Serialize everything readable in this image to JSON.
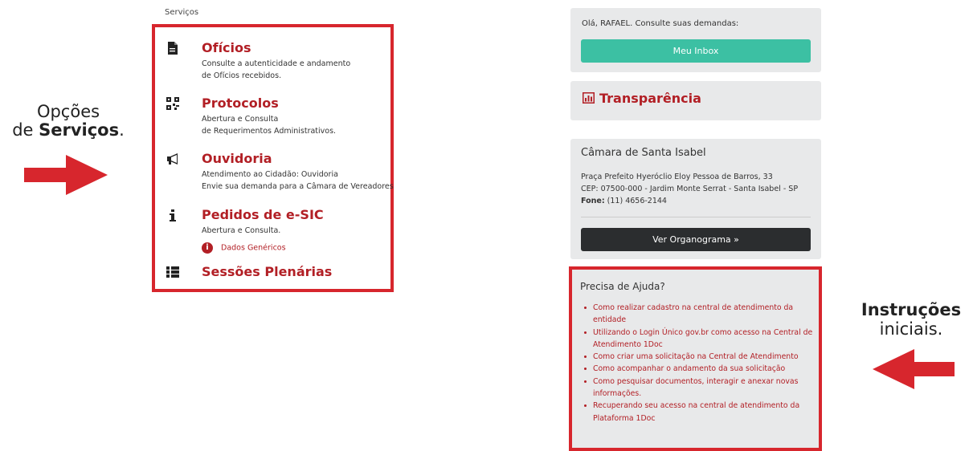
{
  "annotations": {
    "left_line1": "Opções",
    "left_line2_prefix": "de ",
    "left_line2_bold": "Serviços",
    "left_line2_suffix": ".",
    "right_line1": "Instruções",
    "right_line2": "iniciais."
  },
  "services": {
    "caption": "Serviços",
    "items": [
      {
        "icon": "file-icon",
        "title": "Ofícios",
        "desc1": "Consulte a autenticidade e andamento",
        "desc2": "de Ofícios recebidos."
      },
      {
        "icon": "qrcode-icon",
        "title": "Protocolos",
        "desc1": "Abertura e Consulta",
        "desc2": "de Requerimentos Administrativos."
      },
      {
        "icon": "bullhorn-icon",
        "title": "Ouvidoria",
        "desc1": "Atendimento ao Cidadão: Ouvidoria",
        "desc2": "Envie sua demanda para a Câmara de Vereadores"
      },
      {
        "icon": "info-icon",
        "title": "Pedidos de e-SIC",
        "desc1": "Abertura e Consulta.",
        "sub_link": "Dados Genéricos"
      },
      {
        "icon": "list-icon",
        "title": "Sessões Plenárias"
      }
    ]
  },
  "inbox": {
    "greeting": "Olá, RAFAEL. Consulte suas demandas:",
    "button": "Meu Inbox"
  },
  "transparency": {
    "label": "Transparência"
  },
  "camara": {
    "title": "Câmara de Santa Isabel",
    "address": "Praça Prefeito Hyeróclio Eloy Pessoa de Barros, 33",
    "cep": "CEP: 07500-000 - Jardim Monte Serrat - Santa Isabel - SP",
    "phone_label": "Fone:",
    "phone": "(11) 4656-2144",
    "button": "Ver Organograma »"
  },
  "help": {
    "title": "Precisa de Ajuda?",
    "links": [
      [
        "Como realizar cadastro na central de atendimento da",
        "entidade"
      ],
      [
        "Utilizando o Login Único gov.br como acesso na Central de",
        "Atendimento 1Doc"
      ],
      [
        "Como criar uma solicitação na Central de Atendimento"
      ],
      [
        "Como acompanhar o andamento da sua solicitação"
      ],
      [
        "Como pesquisar documentos, interagir e anexar novas",
        "informações."
      ],
      [
        "Recuperando seu acesso na central de atendimento da",
        "Plataforma 1Doc"
      ]
    ]
  },
  "colors": {
    "accent_red": "#b21f25",
    "frame_red": "#d7262d",
    "inbox_green": "#3cc0a3",
    "dark_button": "#2b2d2f"
  }
}
